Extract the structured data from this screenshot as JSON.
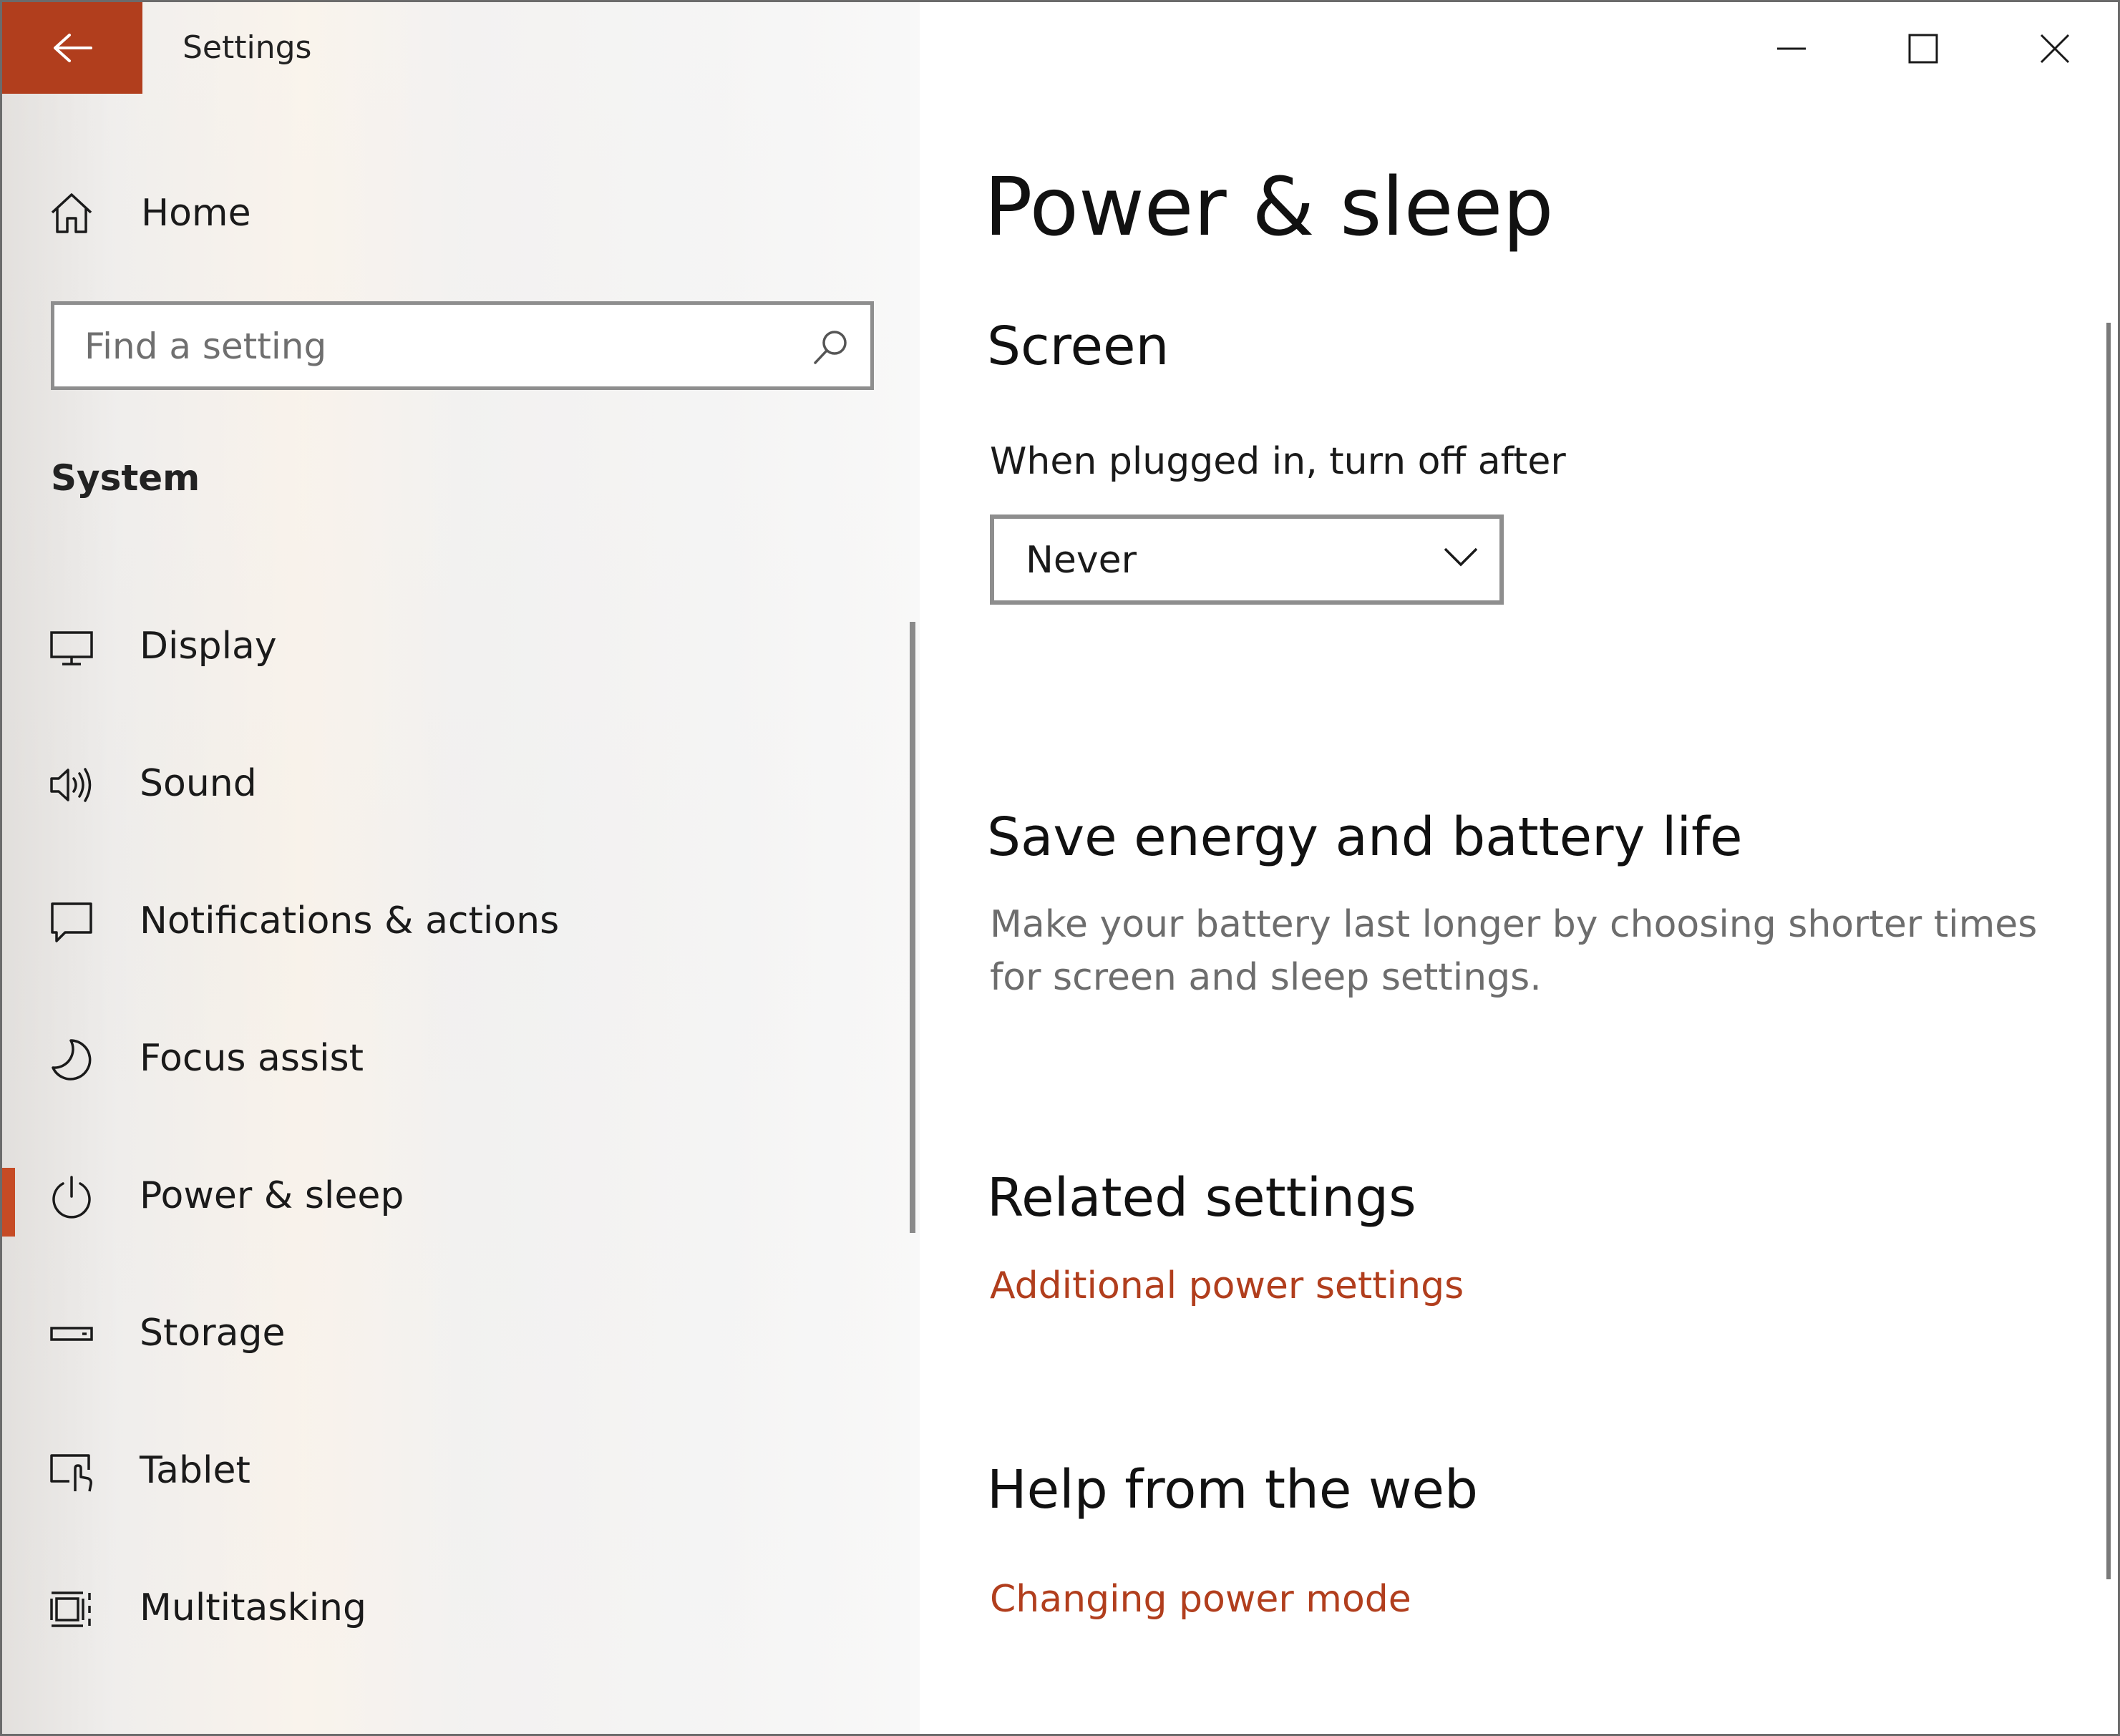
{
  "app": {
    "title": "Settings"
  },
  "colors": {
    "accent": "#b13e1d",
    "selection": "#c64b25"
  },
  "sidebar": {
    "home_label": "Home",
    "search_placeholder": "Find a setting",
    "section": "System",
    "items": [
      {
        "label": "Display",
        "icon": "monitor-icon"
      },
      {
        "label": "Sound",
        "icon": "speaker-icon"
      },
      {
        "label": "Notifications & actions",
        "icon": "notification-icon"
      },
      {
        "label": "Focus assist",
        "icon": "moon-icon"
      },
      {
        "label": "Power & sleep",
        "icon": "power-icon",
        "selected": true
      },
      {
        "label": "Storage",
        "icon": "storage-icon"
      },
      {
        "label": "Tablet",
        "icon": "tablet-icon"
      },
      {
        "label": "Multitasking",
        "icon": "multitasking-icon"
      }
    ]
  },
  "main": {
    "page_title": "Power & sleep",
    "screen": {
      "heading": "Screen",
      "plugged_in_label": "When plugged in, turn off after",
      "plugged_in_value": "Never"
    },
    "save_energy": {
      "heading": "Save energy and battery life",
      "description": "Make your battery last longer by choosing shorter times for screen and sleep settings."
    },
    "related": {
      "heading": "Related settings",
      "link": "Additional power settings"
    },
    "help": {
      "heading": "Help from the web",
      "link": "Changing power mode"
    }
  }
}
